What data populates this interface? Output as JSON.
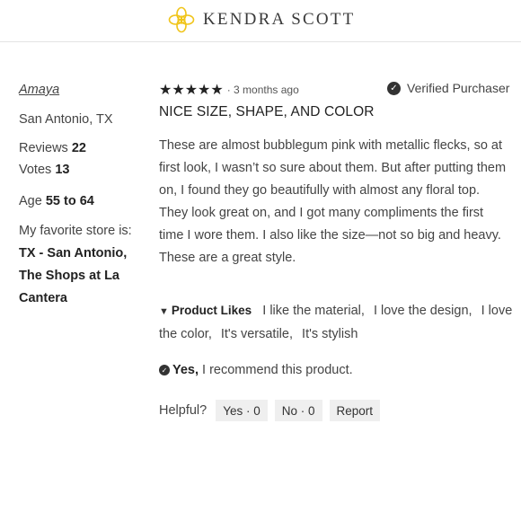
{
  "header": {
    "brand": "KENDRA SCOTT",
    "logo_icon": "kendra-scott-flower-logo",
    "accent_color": "#f0c419"
  },
  "reviewer": {
    "name": "Amaya",
    "location": "San Antonio, TX",
    "reviews_label": "Reviews",
    "reviews_count": "22",
    "votes_label": "Votes",
    "votes_count": "13",
    "age_label": "Age",
    "age_value": "55 to 64",
    "store_label": "My favorite store is:",
    "store_value": "TX - San Antonio, The Shops at La Cantera"
  },
  "review": {
    "stars": "★★★★★",
    "rating": 5,
    "time_ago": "· 3 months ago",
    "verified_label": "Verified Purchaser",
    "title": "NICE SIZE, SHAPE, AND COLOR",
    "body": "These are almost bubblegum pink with metallic flecks, so at first look, I wasn’t so sure about them. But after putting them on, I found they go beautifully with almost any floral top. They look great on, and I got many compliments the first time I wore them. I also like the size—not so big and heavy. These are a great style.",
    "likes_label": "Product Likes",
    "likes": [
      "I like the material,",
      "I love the design,",
      "I love the color,",
      "It's versatile,",
      "It's stylish"
    ],
    "recommend_yes": "Yes,",
    "recommend_text": "I recommend this product.",
    "helpful_label": "Helpful?",
    "yes_button": "Yes · 0",
    "no_button": "No · 0",
    "report_button": "Report"
  }
}
